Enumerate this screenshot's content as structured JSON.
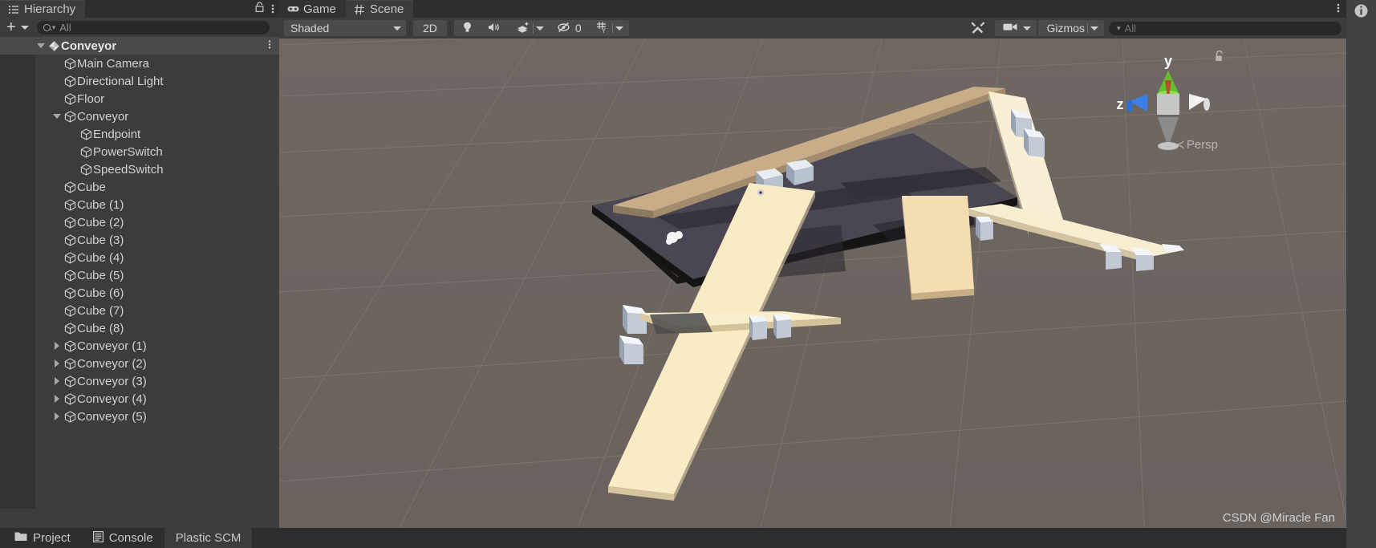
{
  "app": {
    "watermark": "CSDN @Miracle Fan"
  },
  "hierarchy": {
    "tab_label": "Hierarchy",
    "tab_icon": "hierarchy-list-icon",
    "lock_icon": "lock-icon",
    "menu_icon": "kebab-menu-icon",
    "add_label": "+",
    "search": {
      "placeholder": "All",
      "value": "",
      "icon": "search-icon"
    },
    "items": [
      {
        "label": "Conveyor",
        "depth": 0,
        "twisty": "down",
        "icon": "unity-prefab-icon",
        "selected": true,
        "bold": true,
        "kebab": true
      },
      {
        "label": "Main Camera",
        "depth": 1,
        "twisty": "none",
        "icon": "gameobject-cube-icon",
        "selected": false,
        "bold": false,
        "kebab": false
      },
      {
        "label": "Directional Light",
        "depth": 1,
        "twisty": "none",
        "icon": "gameobject-cube-icon",
        "selected": false,
        "bold": false,
        "kebab": false
      },
      {
        "label": "Floor",
        "depth": 1,
        "twisty": "none",
        "icon": "gameobject-cube-icon",
        "selected": false,
        "bold": false,
        "kebab": false
      },
      {
        "label": "Conveyor",
        "depth": 1,
        "twisty": "down",
        "icon": "gameobject-cube-icon",
        "selected": false,
        "bold": false,
        "kebab": false
      },
      {
        "label": "Endpoint",
        "depth": 2,
        "twisty": "none",
        "icon": "gameobject-cube-icon",
        "selected": false,
        "bold": false,
        "kebab": false
      },
      {
        "label": "PowerSwitch",
        "depth": 2,
        "twisty": "none",
        "icon": "gameobject-cube-icon",
        "selected": false,
        "bold": false,
        "kebab": false
      },
      {
        "label": "SpeedSwitch",
        "depth": 2,
        "twisty": "none",
        "icon": "gameobject-cube-icon",
        "selected": false,
        "bold": false,
        "kebab": false
      },
      {
        "label": "Cube",
        "depth": 1,
        "twisty": "none",
        "icon": "gameobject-cube-icon",
        "selected": false,
        "bold": false,
        "kebab": false
      },
      {
        "label": "Cube (1)",
        "depth": 1,
        "twisty": "none",
        "icon": "gameobject-cube-icon",
        "selected": false,
        "bold": false,
        "kebab": false
      },
      {
        "label": "Cube (2)",
        "depth": 1,
        "twisty": "none",
        "icon": "gameobject-cube-icon",
        "selected": false,
        "bold": false,
        "kebab": false
      },
      {
        "label": "Cube (3)",
        "depth": 1,
        "twisty": "none",
        "icon": "gameobject-cube-icon",
        "selected": false,
        "bold": false,
        "kebab": false
      },
      {
        "label": "Cube (4)",
        "depth": 1,
        "twisty": "none",
        "icon": "gameobject-cube-icon",
        "selected": false,
        "bold": false,
        "kebab": false
      },
      {
        "label": "Cube (5)",
        "depth": 1,
        "twisty": "none",
        "icon": "gameobject-cube-icon",
        "selected": false,
        "bold": false,
        "kebab": false
      },
      {
        "label": "Cube (6)",
        "depth": 1,
        "twisty": "none",
        "icon": "gameobject-cube-icon",
        "selected": false,
        "bold": false,
        "kebab": false
      },
      {
        "label": "Cube (7)",
        "depth": 1,
        "twisty": "none",
        "icon": "gameobject-cube-icon",
        "selected": false,
        "bold": false,
        "kebab": false
      },
      {
        "label": "Cube (8)",
        "depth": 1,
        "twisty": "none",
        "icon": "gameobject-cube-icon",
        "selected": false,
        "bold": false,
        "kebab": false
      },
      {
        "label": "Conveyor (1)",
        "depth": 1,
        "twisty": "right",
        "icon": "gameobject-cube-icon",
        "selected": false,
        "bold": false,
        "kebab": false
      },
      {
        "label": "Conveyor (2)",
        "depth": 1,
        "twisty": "right",
        "icon": "gameobject-cube-icon",
        "selected": false,
        "bold": false,
        "kebab": false
      },
      {
        "label": "Conveyor (3)",
        "depth": 1,
        "twisty": "right",
        "icon": "gameobject-cube-icon",
        "selected": false,
        "bold": false,
        "kebab": false
      },
      {
        "label": "Conveyor (4)",
        "depth": 1,
        "twisty": "right",
        "icon": "gameobject-cube-icon",
        "selected": false,
        "bold": false,
        "kebab": false
      },
      {
        "label": "Conveyor (5)",
        "depth": 1,
        "twisty": "right",
        "icon": "gameobject-cube-icon",
        "selected": false,
        "bold": false,
        "kebab": false
      }
    ]
  },
  "scene_panel": {
    "tabs": [
      {
        "label": "Game",
        "icon": "gamepad-icon",
        "active": false
      },
      {
        "label": "Scene",
        "icon": "grid-hash-icon",
        "active": true
      }
    ],
    "menu_icon": "kebab-menu-icon",
    "toolbar": {
      "draw_mode": "Shaded",
      "two_d_label": "2D",
      "lighting_icon": "lightbulb-icon",
      "audio_icon": "speaker-icon",
      "fx_icon": "effects-layers-icon",
      "hidden_objects_icon": "eye-off-icon",
      "hidden_objects_count": "0",
      "grid_icon": "grid-axis-y-icon",
      "tools_icon": "tools-icon",
      "camera_icon": "camera-icon",
      "gizmos_label": "Gizmos",
      "search": {
        "placeholder": "All",
        "value": "",
        "icon": "search-icon"
      }
    },
    "viewport": {
      "projection_label": "Persp",
      "projection_toggle_icon": "chevron-left-icon",
      "axis_labels": {
        "y": "y",
        "z": "z"
      },
      "lock_icon": "unlocked-padlock-icon",
      "background_color": "#6d6561",
      "grid_line_color": "#7c7570",
      "floor_color": "#4a4751",
      "belt_color": "#f5e2b4",
      "belt_dark_color": "#c8ab86",
      "roller_color": "#e9edf2",
      "roller_shadow_color": "#8b96a6"
    }
  },
  "bottom_dock": {
    "tabs": [
      {
        "label": "Project",
        "icon": "folder-icon",
        "active": false
      },
      {
        "label": "Console",
        "icon": "console-icon",
        "active": false
      },
      {
        "label": "Plastic SCM",
        "icon": "",
        "active": true
      }
    ]
  },
  "right_sliver": {
    "info_icon": "info-circle-icon"
  }
}
